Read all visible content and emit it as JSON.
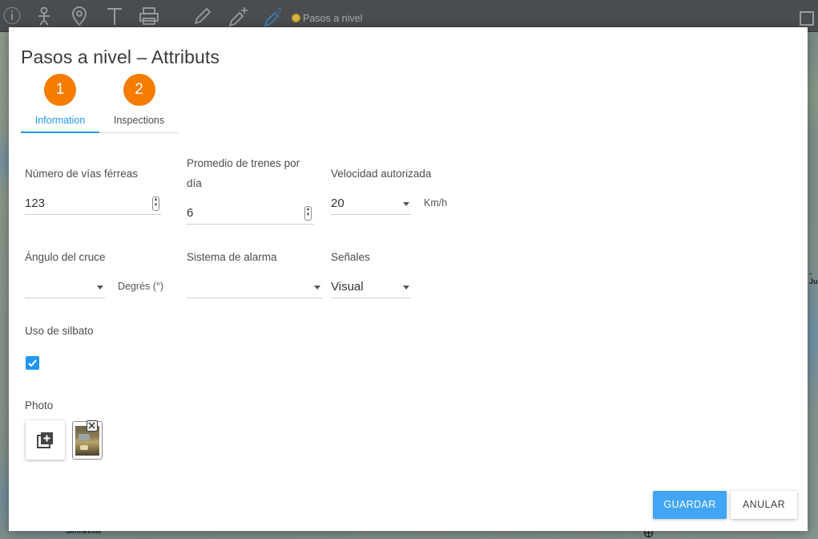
{
  "toolbar": {
    "layer_title": "Pasos a nivel",
    "icons": [
      "info-icon",
      "person-icon",
      "location-pin-icon",
      "text-icon",
      "print-icon",
      "pencil-icon",
      "pencil-plus-icon",
      "pencil-question-icon",
      "crosshair-icon",
      "window-icon"
    ]
  },
  "map": {
    "label_left": "Senneville",
    "label_right": "-Ju"
  },
  "dialog": {
    "title": "Pasos a nivel – Attributs",
    "tabs": [
      {
        "number": "1",
        "label": "Information",
        "active": true
      },
      {
        "number": "2",
        "label": "Inspections",
        "active": false
      }
    ],
    "fields": {
      "numero_vias": {
        "label": "Número de vías férreas",
        "value": "123"
      },
      "promedio_trenes": {
        "label_line1": "Promedio de trenes por",
        "label_line2": "día",
        "value": "6"
      },
      "velocidad": {
        "label": "Velocidad autorizada",
        "value": "20",
        "unit": "Km/h"
      },
      "angulo": {
        "label": "Ángulo del cruce",
        "value": "",
        "unit": "Degrés (°)"
      },
      "alarma": {
        "label": "Sistema de alarma",
        "value": ""
      },
      "senales": {
        "label": "Señales",
        "value": "Visual"
      },
      "silbato": {
        "label": "Uso de silbato",
        "checked": true
      },
      "photo": {
        "label": "Photo"
      }
    },
    "buttons": {
      "save": "GUARDAR",
      "cancel": "ANULAR"
    }
  },
  "colors": {
    "accent": "#2196f3",
    "step": "#f57c00",
    "save_button": "#42a5f5",
    "toolbar": "#4a4d4f"
  }
}
